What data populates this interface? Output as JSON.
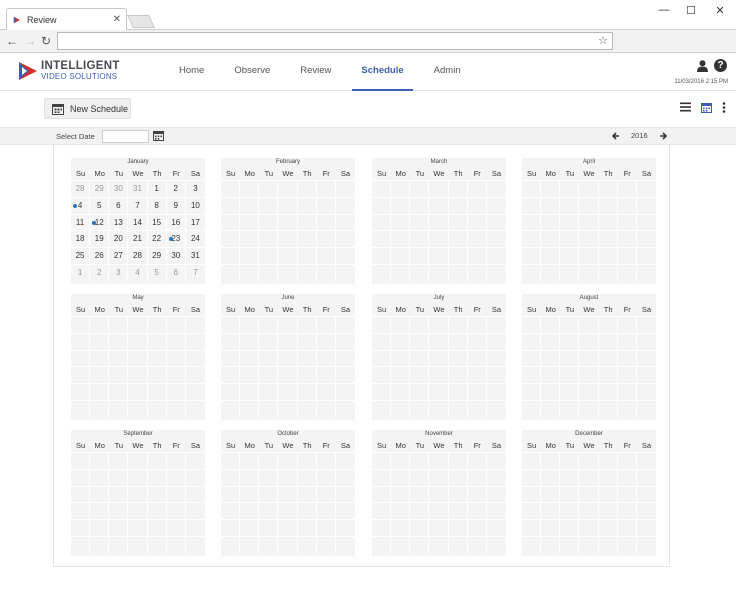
{
  "browser": {
    "tab_title": "Review",
    "window_controls": {
      "minimize": "—",
      "maximize": "☐",
      "close": "✕"
    },
    "nav": {
      "back": "←",
      "forward": "→",
      "reload": "↻",
      "star": "☆"
    },
    "url": ""
  },
  "app": {
    "logo_line1": "INTELLIGENT",
    "logo_line2": "VIDEO SOLUTIONS",
    "nav": [
      {
        "label": "Home"
      },
      {
        "label": "Observe"
      },
      {
        "label": "Review"
      },
      {
        "label": "Schedule",
        "active": true
      },
      {
        "label": "Admin"
      }
    ],
    "datetime": "11/03/2016 2:15 PM",
    "help_label": "?"
  },
  "actions": {
    "new_schedule": "New Schedule"
  },
  "date_bar": {
    "select_label": "Select Date",
    "select_value": "",
    "year": "2016",
    "prev": "◀",
    "next": "▶"
  },
  "calendar": {
    "weekdays": [
      "Su",
      "Mo",
      "Tu",
      "We",
      "Th",
      "Fr",
      "Sa"
    ],
    "months": [
      {
        "name": "January",
        "weeks": [
          [
            {
              "d": "28",
              "muted": true
            },
            {
              "d": "29",
              "muted": true
            },
            {
              "d": "30",
              "muted": true
            },
            {
              "d": "31",
              "muted": true
            },
            {
              "d": "1"
            },
            {
              "d": "2"
            },
            {
              "d": "3"
            }
          ],
          [
            {
              "d": "4",
              "dot": true
            },
            {
              "d": "5"
            },
            {
              "d": "6"
            },
            {
              "d": "7"
            },
            {
              "d": "8"
            },
            {
              "d": "9"
            },
            {
              "d": "10"
            }
          ],
          [
            {
              "d": "11"
            },
            {
              "d": "12",
              "dot": true
            },
            {
              "d": "13"
            },
            {
              "d": "14"
            },
            {
              "d": "15"
            },
            {
              "d": "16"
            },
            {
              "d": "17"
            }
          ],
          [
            {
              "d": "18"
            },
            {
              "d": "19"
            },
            {
              "d": "20"
            },
            {
              "d": "21"
            },
            {
              "d": "22"
            },
            {
              "d": "23",
              "dot": true
            },
            {
              "d": "24"
            }
          ],
          [
            {
              "d": "25"
            },
            {
              "d": "26"
            },
            {
              "d": "27"
            },
            {
              "d": "28"
            },
            {
              "d": "29"
            },
            {
              "d": "30"
            },
            {
              "d": "31"
            }
          ],
          [
            {
              "d": "1",
              "muted": true
            },
            {
              "d": "2",
              "muted": true
            },
            {
              "d": "3",
              "muted": true
            },
            {
              "d": "4",
              "muted": true
            },
            {
              "d": "5",
              "muted": true
            },
            {
              "d": "6",
              "muted": true
            },
            {
              "d": "7",
              "muted": true
            }
          ]
        ]
      },
      {
        "name": "February",
        "weeks": []
      },
      {
        "name": "March",
        "weeks": []
      },
      {
        "name": "April",
        "weeks": []
      },
      {
        "name": "May",
        "weeks": []
      },
      {
        "name": "June",
        "weeks": []
      },
      {
        "name": "July",
        "weeks": []
      },
      {
        "name": "August",
        "weeks": []
      },
      {
        "name": "September",
        "weeks": []
      },
      {
        "name": "October",
        "weeks": []
      },
      {
        "name": "November",
        "weeks": []
      },
      {
        "name": "December",
        "weeks": []
      }
    ]
  },
  "colors": {
    "accent": "#3c5fb0",
    "event_dot": "#2c72b8",
    "month_bg": "#f4f4f4"
  }
}
